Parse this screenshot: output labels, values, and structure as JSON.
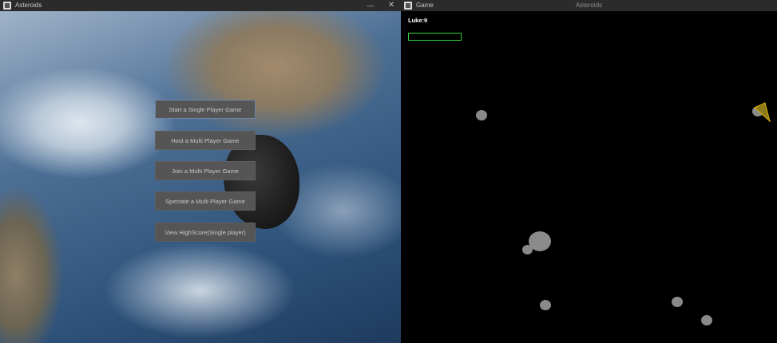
{
  "menu_window": {
    "title": "Asteroids",
    "controls": {
      "minimize": "—",
      "close": "✕"
    },
    "buttons": [
      "Start a Single Player Game",
      "Host a Multi Player Game",
      "Join a Multi Player Game",
      "Spectate a Multi Player Game",
      "View HighScore(Single player)"
    ]
  },
  "game_window": {
    "title": "Game",
    "center_title": "Asteroids",
    "player_label": "Luke:9",
    "health": 0,
    "colors": {
      "background": "#000000",
      "asteroid": "#8a8a8a",
      "health_border": "#2fd23a",
      "ship_fill": "#8a7a1a",
      "ship_outline": "#e0b000"
    }
  }
}
